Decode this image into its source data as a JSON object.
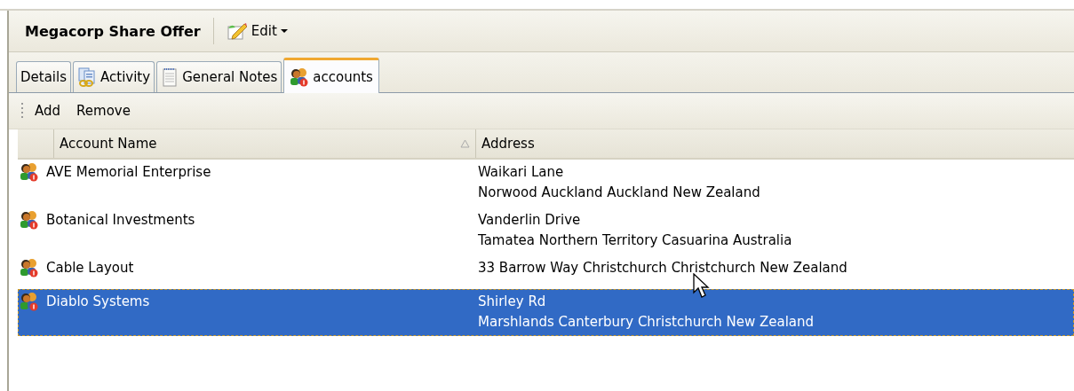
{
  "record": {
    "title": "Megacorp Share Offer",
    "edit_menu": "Edit"
  },
  "tabs": [
    {
      "label": "Details",
      "kind": "plain",
      "selected": false
    },
    {
      "label": "Activity",
      "kind": "activity",
      "selected": false
    },
    {
      "label": "General Notes",
      "kind": "notes",
      "selected": false
    },
    {
      "label": "accounts",
      "kind": "accounts",
      "selected": true
    }
  ],
  "toolbar": [
    "Add",
    "Remove"
  ],
  "table": {
    "columns": [
      {
        "label": "Account Name",
        "sorted": true
      },
      {
        "label": "Address",
        "sorted": false
      }
    ],
    "rows": [
      {
        "name": "AVE Memorial Enterprise",
        "address": [
          "Waikari Lane",
          "Norwood Auckland Auckland New Zealand"
        ],
        "selected": false
      },
      {
        "name": "Botanical Investments",
        "address": [
          "Vanderlin Drive",
          "Tamatea Northern Territory Casuarina Australia"
        ],
        "selected": false
      },
      {
        "name": "Cable Layout",
        "address": [
          "33 Barrow Way Christchurch Christchurch New Zealand"
        ],
        "selected": false
      },
      {
        "name": "Diablo Systems",
        "address": [
          "Shirley Rd",
          "Marshlands Canterbury Christchurch New Zealand"
        ],
        "selected": true
      }
    ]
  }
}
